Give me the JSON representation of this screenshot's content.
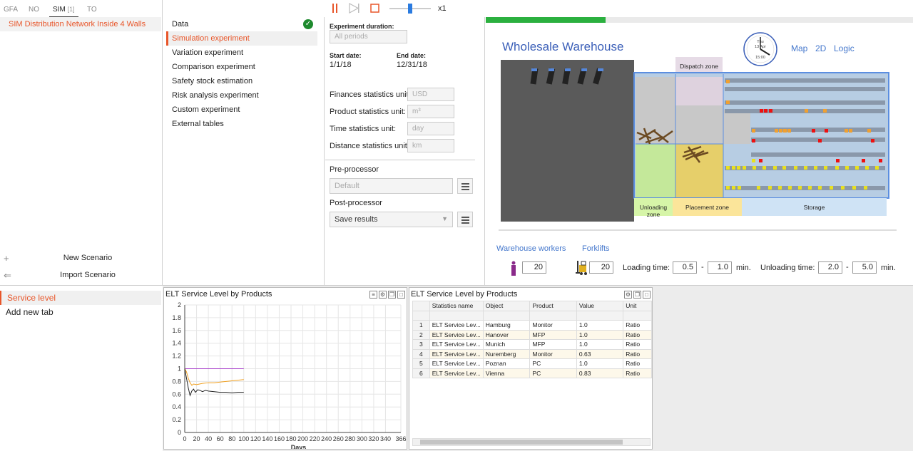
{
  "top_tabs": [
    {
      "label": "GFA",
      "count": ""
    },
    {
      "label": "NO",
      "count": ""
    },
    {
      "label": "SIM",
      "count": "[1]"
    },
    {
      "label": "TO",
      "count": ""
    }
  ],
  "scenario": {
    "selected": "SIM Distribution Network Inside 4 Walls",
    "new_label": "New Scenario",
    "import_label": "Import Scenario"
  },
  "experiments": {
    "items": [
      "Data",
      "Simulation experiment",
      "Variation experiment",
      "Comparison experiment",
      "Safety stock estimation",
      "Risk analysis experiment",
      "Custom experiment",
      "External tables"
    ]
  },
  "settings": {
    "duration_label": "Experiment duration:",
    "duration_value": "All periods",
    "start_label": "Start date:",
    "start_value": "1/1/18",
    "end_label": "End date:",
    "end_value": "12/31/18",
    "units": [
      {
        "label": "Finances statistics unit:",
        "value": "USD"
      },
      {
        "label": "Product statistics unit:",
        "value": "m³"
      },
      {
        "label": "Time statistics unit:",
        "value": "day"
      },
      {
        "label": "Distance statistics unit:",
        "value": "km"
      }
    ],
    "pre_label": "Pre-processor",
    "pre_value": "Default",
    "post_label": "Post-processor",
    "post_value": "Save results"
  },
  "toolbar": {
    "speed": "x1",
    "speed_level": 0.5
  },
  "model": {
    "progress": 0.28,
    "title": "Wholesale Warehouse",
    "clock": {
      "line1": "Thu",
      "line2": "13 Apr",
      "line3": "15:00"
    },
    "links": [
      "Map",
      "2D",
      "Logic"
    ],
    "zones": {
      "dispatch": "Dispatch zone",
      "unloading": "Unloading zone",
      "placement": "Placement zone",
      "storage": "Storage"
    },
    "workers_label": "Warehouse workers",
    "forklifts_label": "Forklifts",
    "workers_value": "20",
    "forklifts_value": "20",
    "loading_label": "Loading time:",
    "loading_min": "0.5",
    "loading_max": "1.0",
    "unloading_label": "Unloading time:",
    "unloading_min": "2.0",
    "unloading_max": "5.0",
    "dash": "-",
    "unit": "min.",
    "colors": {
      "accent": "#3b5fb8",
      "progress": "#2bb03f",
      "dispatch": "#e6dbe6",
      "unloading": "#d6f5a8",
      "placement": "#fbe59a",
      "storage": "#cfe3f5"
    }
  },
  "bottom_tabs": {
    "items": [
      "Service level",
      "Add new tab"
    ]
  },
  "chart_panel": {
    "title": "ELT Service Level by Products"
  },
  "chart_data": {
    "type": "line",
    "title": "",
    "xlabel": "Days",
    "ylabel": "",
    "xlim": [
      0,
      366
    ],
    "ylim": [
      0,
      2
    ],
    "xticks": [
      0,
      20,
      40,
      60,
      80,
      100,
      120,
      140,
      160,
      180,
      200,
      220,
      240,
      260,
      280,
      300,
      320,
      340,
      366
    ],
    "yticks": [
      0,
      0.2,
      0.4,
      0.6,
      0.8,
      1,
      1.2,
      1.4,
      1.6,
      1.8,
      2
    ],
    "grid": true,
    "series": [
      {
        "color": "#aa44cc",
        "x": [
          0,
          100
        ],
        "y": [
          1.0,
          1.0
        ]
      },
      {
        "color": "#f0a020",
        "x": [
          0,
          3,
          6,
          9,
          12,
          15,
          20,
          25,
          30,
          40,
          50,
          60,
          70,
          80,
          90,
          100
        ],
        "y": [
          1.0,
          0.95,
          0.85,
          0.78,
          0.74,
          0.76,
          0.75,
          0.76,
          0.77,
          0.78,
          0.78,
          0.79,
          0.8,
          0.81,
          0.82,
          0.83
        ]
      },
      {
        "color": "#222222",
        "x": [
          0,
          3,
          6,
          9,
          12,
          15,
          18,
          22,
          26,
          30,
          35,
          40,
          50,
          60,
          70,
          80,
          90,
          100
        ],
        "y": [
          1.0,
          0.85,
          0.7,
          0.58,
          0.65,
          0.68,
          0.63,
          0.67,
          0.66,
          0.64,
          0.66,
          0.65,
          0.64,
          0.63,
          0.63,
          0.62,
          0.63,
          0.63
        ]
      }
    ]
  },
  "table_panel": {
    "title": "ELT Service Level by Products",
    "columns": [
      "Statistics name",
      "Object",
      "Product",
      "Value",
      "Unit"
    ],
    "rows": [
      [
        "1",
        "ELT Service Lev...",
        "Hamburg",
        "Monitor",
        "1.0",
        "Ratio"
      ],
      [
        "2",
        "ELT Service Lev...",
        "Hanover",
        "MFP",
        "1.0",
        "Ratio"
      ],
      [
        "3",
        "ELT Service Lev...",
        "Munich",
        "MFP",
        "1.0",
        "Ratio"
      ],
      [
        "4",
        "ELT Service Lev...",
        "Nuremberg",
        "Monitor",
        "0.63",
        "Ratio"
      ],
      [
        "5",
        "ELT Service Lev...",
        "Poznan",
        "PC",
        "1.0",
        "Ratio"
      ],
      [
        "6",
        "ELT Service Lev...",
        "Vienna",
        "PC",
        "0.83",
        "Ratio"
      ]
    ]
  }
}
